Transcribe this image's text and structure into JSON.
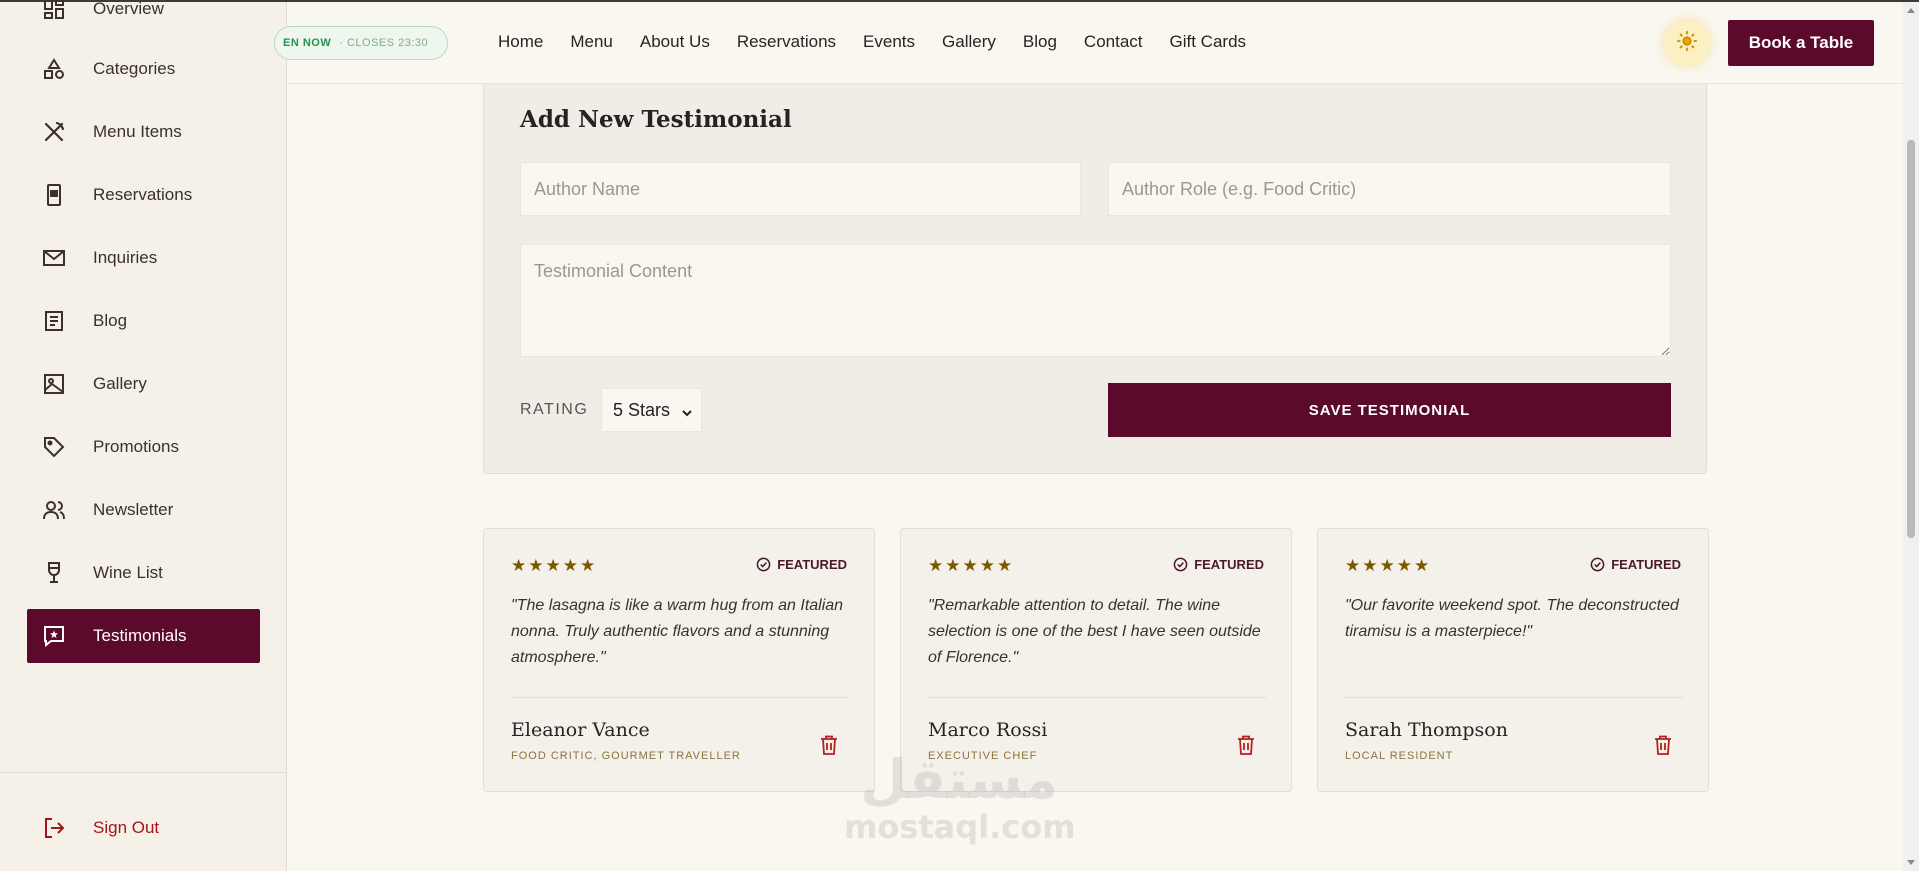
{
  "sidebar": {
    "items": [
      {
        "label": "Overview",
        "icon": "grid-icon"
      },
      {
        "label": "Categories",
        "icon": "shapes-icon"
      },
      {
        "label": "Menu Items",
        "icon": "utensils-icon"
      },
      {
        "label": "Reservations",
        "icon": "tablet-icon"
      },
      {
        "label": "Inquiries",
        "icon": "mail-icon"
      },
      {
        "label": "Blog",
        "icon": "document-icon"
      },
      {
        "label": "Gallery",
        "icon": "image-icon"
      },
      {
        "label": "Promotions",
        "icon": "tag-icon"
      },
      {
        "label": "Newsletter",
        "icon": "users-icon"
      },
      {
        "label": "Wine List",
        "icon": "wine-glass-icon"
      },
      {
        "label": "Testimonials",
        "icon": "star-message-icon",
        "active": true
      }
    ],
    "signout": "Sign Out"
  },
  "header": {
    "open_now": "EN NOW",
    "closes": "· CLOSES 23:30",
    "nav": [
      "Home",
      "Menu",
      "About Us",
      "Reservations",
      "Events",
      "Gallery",
      "Blog",
      "Contact",
      "Gift Cards"
    ],
    "theme_icon": "sun-icon",
    "book_label": "Book a Table"
  },
  "form": {
    "title": "Add New Testimonial",
    "author_name_placeholder": "Author Name",
    "author_role_placeholder": "Author Role (e.g. Food Critic)",
    "content_placeholder": "Testimonial Content",
    "rating_label": "RATING",
    "rating_value": "5 Stars",
    "save_label": "SAVE TESTIMONIAL"
  },
  "testimonials": [
    {
      "rating": 5,
      "featured": "FEATURED",
      "quote": "\"The lasagna is like a warm hug from an Italian nonna. Truly authentic flavors and a stunning atmosphere.\"",
      "author": "Eleanor Vance",
      "role": "FOOD CRITIC, GOURMET TRAVELLER"
    },
    {
      "rating": 5,
      "featured": "FEATURED",
      "quote": "\"Remarkable attention to detail. The wine selection is one of the best I have seen outside of Florence.\"",
      "author": "Marco Rossi",
      "role": "EXECUTIVE CHEF"
    },
    {
      "rating": 5,
      "featured": "FEATURED",
      "quote": "\"Our favorite weekend spot. The deconstructed tiramisu is a masterpiece!\"",
      "author": "Sarah Thompson",
      "role": "LOCAL RESIDENT"
    }
  ],
  "watermark": {
    "arabic": "مستقل",
    "latin": "mostaql.com"
  },
  "colors": {
    "accent": "#5c0a2c",
    "star": "#7a5a00",
    "open_green": "#23944a",
    "danger": "#a01818"
  }
}
